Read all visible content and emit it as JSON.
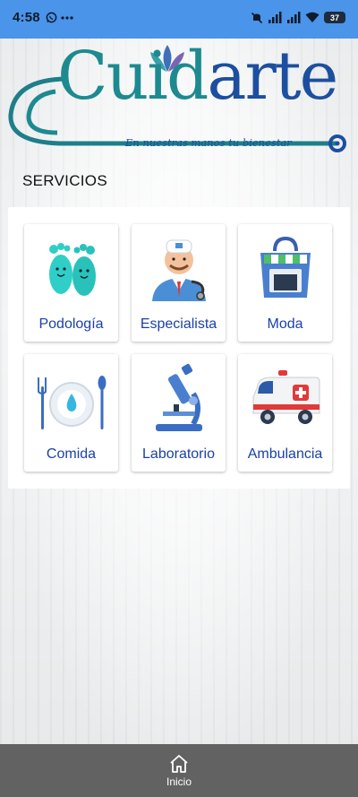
{
  "status_bar": {
    "time": "4:58",
    "battery": "37",
    "icons": [
      "whatsapp-icon",
      "more-icon",
      "mute-icon",
      "signal-icon",
      "signal-icon",
      "wifi-icon",
      "battery-icon"
    ]
  },
  "logo": {
    "part1": "Cuid",
    "part2": "arte",
    "tagline": "En nuestras manos tu bienestar",
    "colors": {
      "teal": "#1d8a90",
      "blue": "#1d4fa0"
    }
  },
  "section_title": "SERVICIOS",
  "services": [
    {
      "label": "Podología",
      "icon": "feet-icon"
    },
    {
      "label": "Especialista",
      "icon": "doctor-icon"
    },
    {
      "label": "Moda",
      "icon": "shopping-bag-icon"
    },
    {
      "label": "Comida",
      "icon": "plate-cutlery-icon"
    },
    {
      "label": "Laboratorio",
      "icon": "microscope-icon"
    },
    {
      "label": "Ambulancia",
      "icon": "ambulance-icon"
    }
  ],
  "bottom_nav": {
    "items": [
      {
        "label": "Inicio",
        "icon": "home-icon"
      }
    ]
  },
  "colors": {
    "status_bar": "#4a94ea",
    "label_text": "#1b41a8",
    "bottom_nav": "#626262"
  }
}
